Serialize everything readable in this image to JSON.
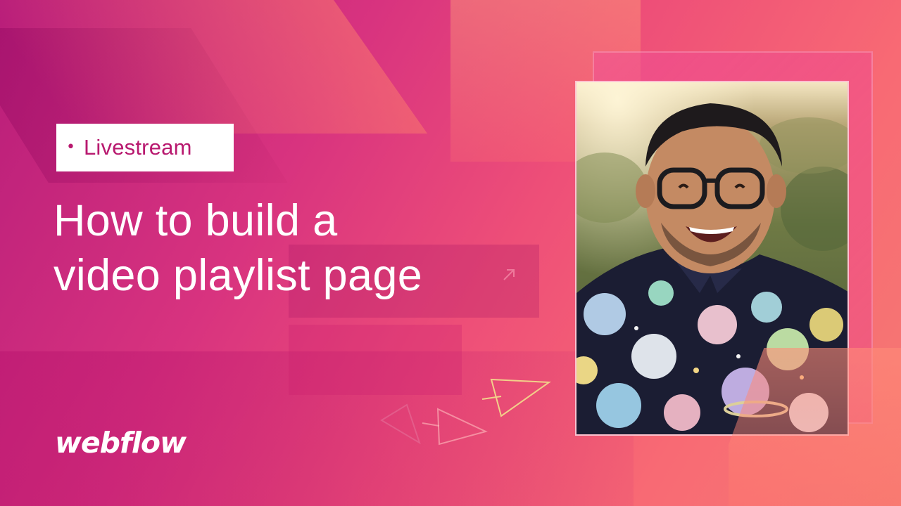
{
  "badge": {
    "bullet": "•",
    "label": "Livestream"
  },
  "title": {
    "line1": "How to build a",
    "line2": "video playlist page"
  },
  "brand": {
    "logo": "webflow"
  },
  "colors": {
    "accent": "#b8196f",
    "background_start": "#b81d7a",
    "background_end": "#f57a72",
    "text": "#ffffff"
  },
  "icons": [
    "arrow-outline-icon",
    "play-triangle-outline-icon"
  ]
}
